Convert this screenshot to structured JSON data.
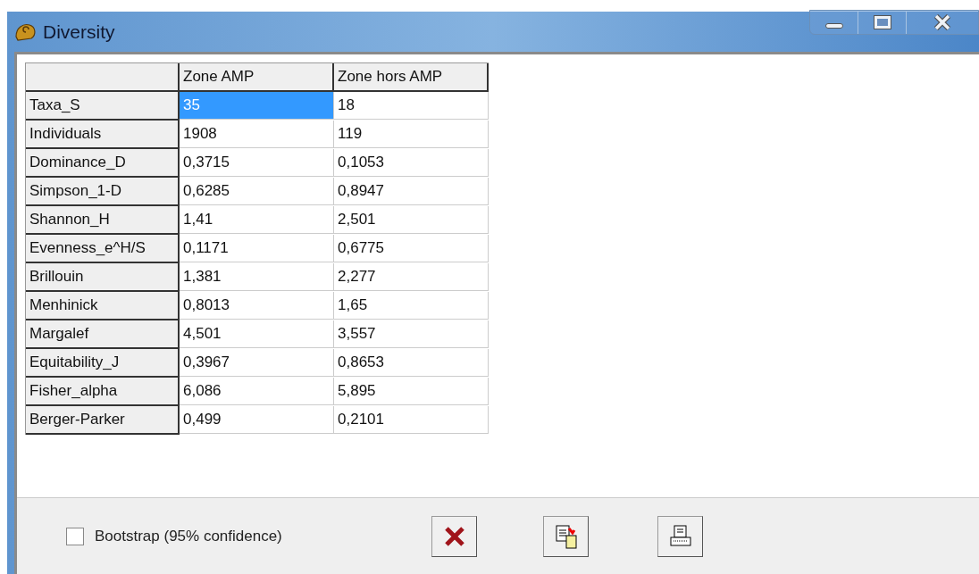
{
  "window": {
    "title": "Diversity"
  },
  "table": {
    "columns": [
      "Zone AMP",
      "Zone hors AMP"
    ],
    "rows": [
      {
        "label": "Taxa_S",
        "cells": [
          {
            "text": "35",
            "selected": true
          },
          {
            "text": "18",
            "selected": false
          }
        ]
      },
      {
        "label": "Individuals",
        "cells": [
          {
            "text": "1908",
            "selected": false
          },
          {
            "text": "119",
            "selected": false
          }
        ]
      },
      {
        "label": "Dominance_D",
        "cells": [
          {
            "text": "0,3715",
            "selected": false
          },
          {
            "text": "0,1053",
            "selected": false
          }
        ]
      },
      {
        "label": "Simpson_1-D",
        "cells": [
          {
            "text": "0,6285",
            "selected": false
          },
          {
            "text": "0,8947",
            "selected": false
          }
        ]
      },
      {
        "label": "Shannon_H",
        "cells": [
          {
            "text": "1,41",
            "selected": false
          },
          {
            "text": "2,501",
            "selected": false
          }
        ]
      },
      {
        "label": "Evenness_e^H/S",
        "cells": [
          {
            "text": "0,1171",
            "selected": false
          },
          {
            "text": "0,6775",
            "selected": false
          }
        ]
      },
      {
        "label": "Brillouin",
        "cells": [
          {
            "text": "1,381",
            "selected": false
          },
          {
            "text": "2,277",
            "selected": false
          }
        ]
      },
      {
        "label": "Menhinick",
        "cells": [
          {
            "text": "0,8013",
            "selected": false
          },
          {
            "text": "1,65",
            "selected": false
          }
        ]
      },
      {
        "label": "Margalef",
        "cells": [
          {
            "text": "4,501",
            "selected": false
          },
          {
            "text": "3,557",
            "selected": false
          }
        ]
      },
      {
        "label": "Equitability_J",
        "cells": [
          {
            "text": "0,3967",
            "selected": false
          },
          {
            "text": "0,8653",
            "selected": false
          }
        ]
      },
      {
        "label": "Fisher_alpha",
        "cells": [
          {
            "text": "6,086",
            "selected": false
          },
          {
            "text": "5,895",
            "selected": false
          }
        ]
      },
      {
        "label": "Berger-Parker",
        "cells": [
          {
            "text": "0,499",
            "selected": false
          },
          {
            "text": "0,2101",
            "selected": false
          }
        ]
      }
    ]
  },
  "bootstrap": {
    "label": "Bootstrap (95% confidence)",
    "checked": false
  }
}
